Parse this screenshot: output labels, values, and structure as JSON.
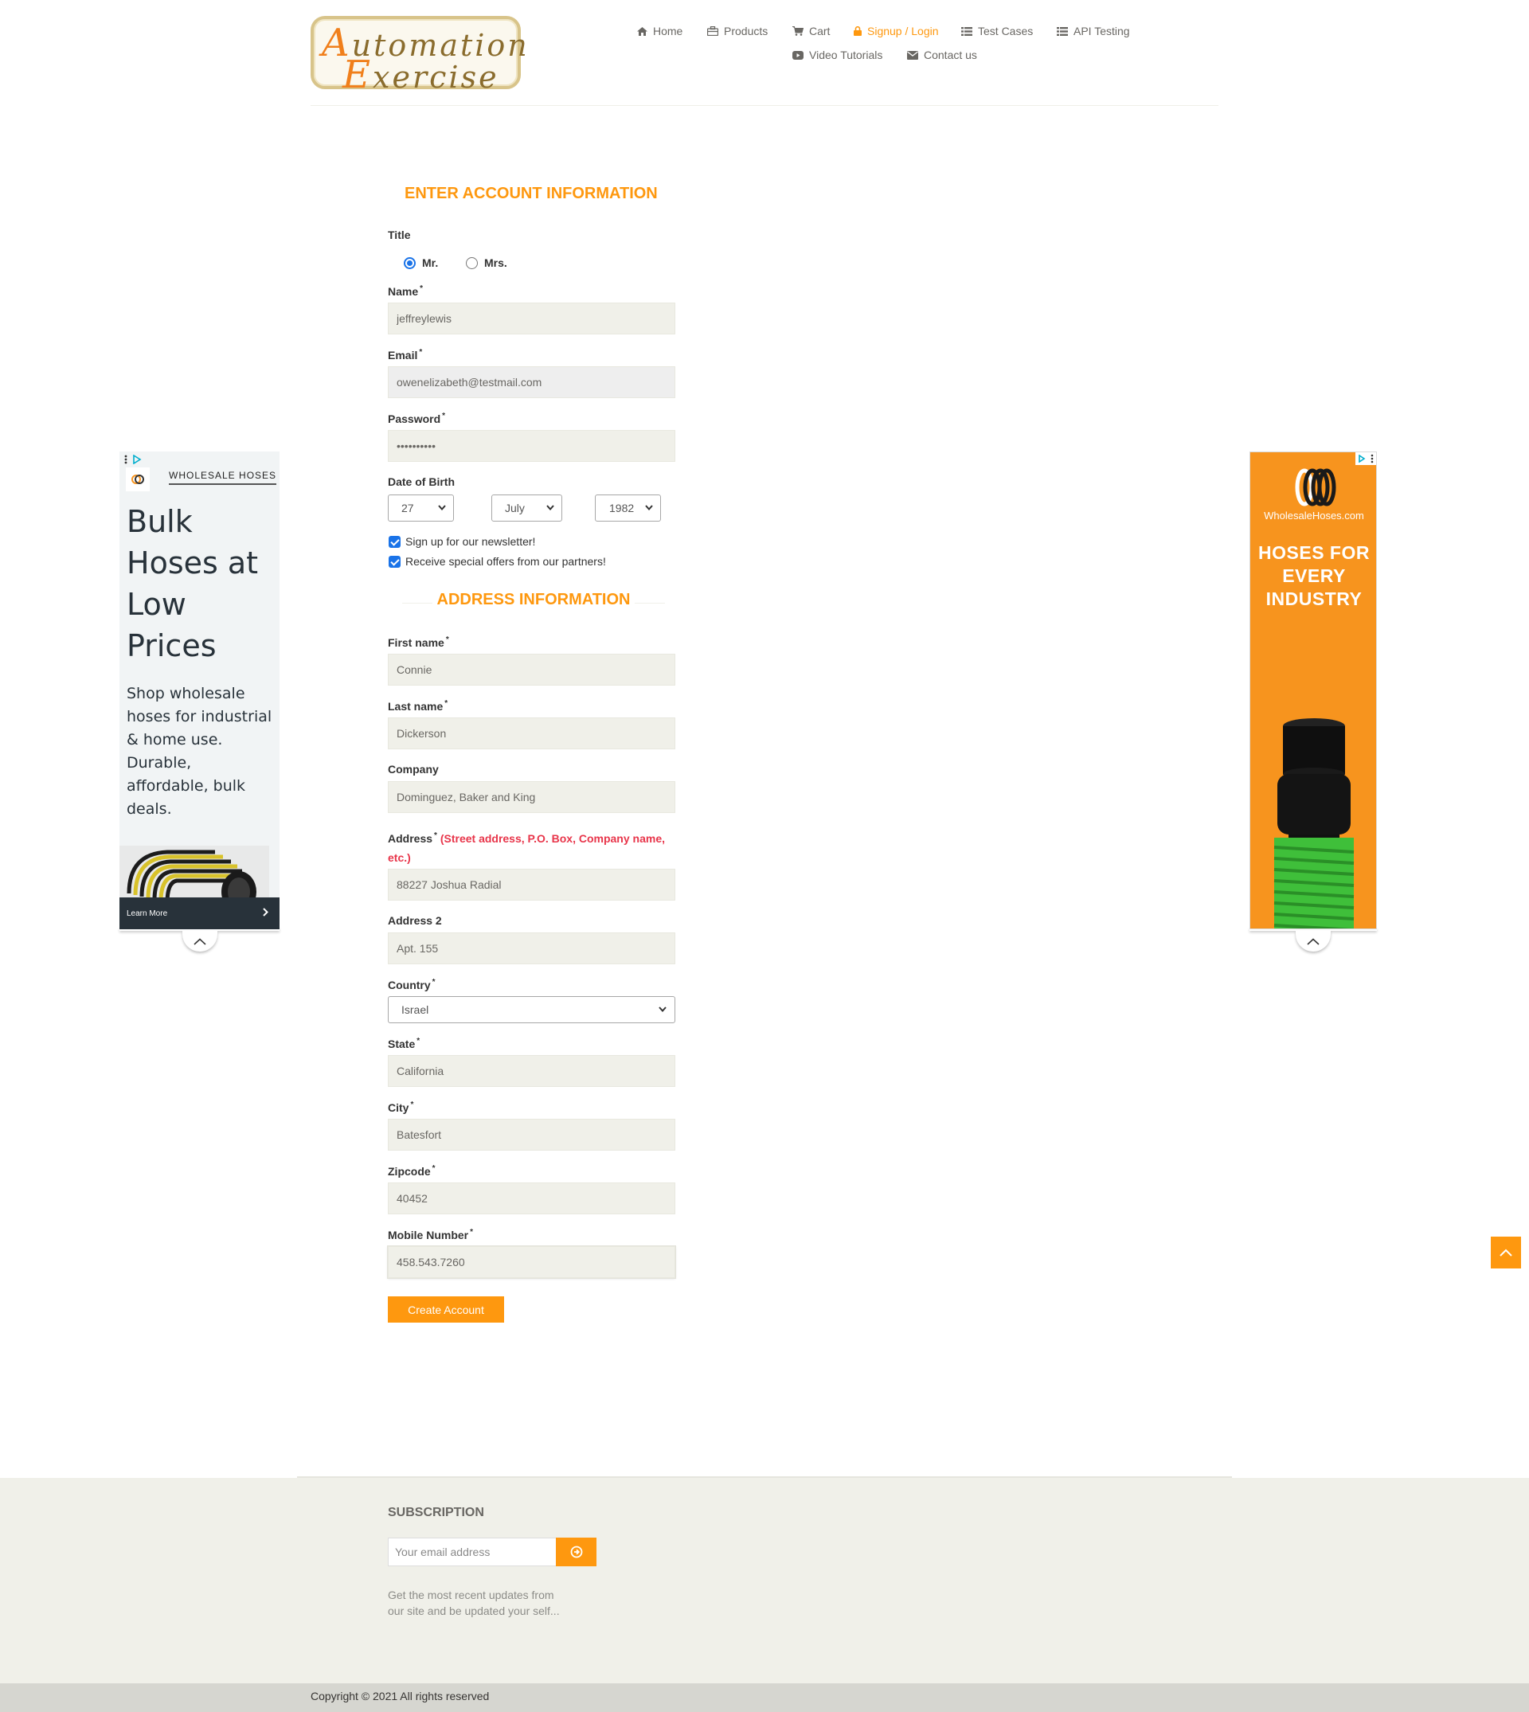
{
  "header": {
    "logo_text": "Automation Exercise",
    "nav": {
      "home": "Home",
      "products": "Products",
      "cart": "Cart",
      "signup_login": "Signup / Login",
      "test_cases": "Test Cases",
      "api_testing": "API Testing",
      "video_tutorials": "Video Tutorials",
      "contact_us": "Contact us"
    },
    "active_item": "Signup / Login",
    "icons": [
      "home-icon",
      "products-icon",
      "cart-icon",
      "lock-icon",
      "list-icon",
      "list-icon",
      "youtube-icon",
      "envelope-icon"
    ]
  },
  "account": {
    "section_title": "ENTER ACCOUNT INFORMATION",
    "title_label": "Title",
    "title_options": [
      "Mr.",
      "Mrs."
    ],
    "title_selected": "Mr.",
    "name_label": "Name",
    "name_value": "jeffreylewis",
    "email_label": "Email",
    "email_value": "owenelizabeth@testmail.com",
    "password_label": "Password",
    "password_value": "••••••••••",
    "dob_label": "Date of Birth",
    "dob_day": "27",
    "dob_month": "July",
    "dob_year": "1982",
    "newsletter_label": "Sign up for our newsletter!",
    "newsletter_checked": true,
    "offers_label": "Receive special offers from our partners!",
    "offers_checked": true,
    "required_mark": "*"
  },
  "address": {
    "section_title": "ADDRESS INFORMATION",
    "first_name_label": "First name",
    "first_name_value": "Connie",
    "last_name_label": "Last name",
    "last_name_value": "Dickerson",
    "company_label": "Company",
    "company_value": "Dominguez, Baker and King",
    "address_label": "Address",
    "address_hint": "(Street address, P.O. Box, Company name, etc.)",
    "address_value": "88227 Joshua Radial",
    "address2_label": "Address 2",
    "address2_value": "Apt. 155",
    "country_label": "Country",
    "country_value": "Israel",
    "state_label": "State",
    "state_value": "California",
    "city_label": "City",
    "city_value": "Batesfort",
    "zipcode_label": "Zipcode",
    "zipcode_value": "40452",
    "mobile_label": "Mobile Number",
    "mobile_value": "458.543.7260",
    "create_button": "Create Account"
  },
  "ads": {
    "left": {
      "brand": "WHOLESALE HOSES",
      "headline": "Bulk Hoses at Low Prices",
      "body": "Shop wholesale hoses for industrial & home use. Durable, affordable, bulk deals.",
      "cta": "Learn More"
    },
    "right": {
      "site": "WholesaleHoses.com",
      "tagline": "HOSES FOR EVERY INDUSTRY"
    }
  },
  "footer": {
    "subscription_title": "SUBSCRIPTION",
    "email_placeholder": "Your email address",
    "subscription_desc": "Get the most recent updates from our site and be updated your self...",
    "copyright": "Copyright © 2021 All rights reserved"
  },
  "colors": {
    "accent": "#fe980f",
    "input_bg": "#f0f0e9",
    "footer_bg": "#f0f0e9",
    "hint_red": "#e8354a",
    "ad_orange": "#f7941e"
  }
}
